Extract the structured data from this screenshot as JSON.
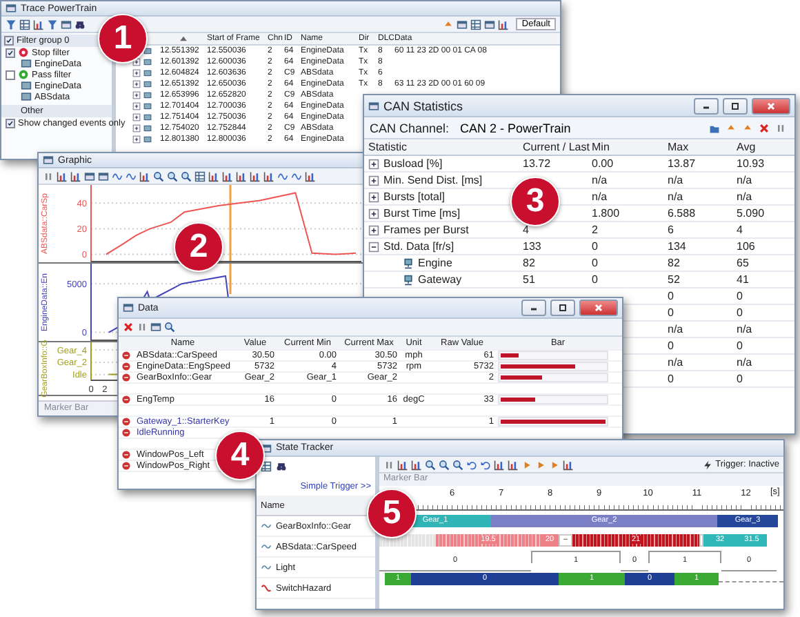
{
  "badges": [
    "1",
    "2",
    "3",
    "4",
    "5"
  ],
  "trace": {
    "title": "Trace PowerTrain",
    "view": "Default",
    "filter_group": {
      "label": "Filter group 0",
      "checked": true
    },
    "filters": [
      {
        "kind": "stop",
        "label": "Stop filter",
        "checked": true,
        "children": [
          "EngineData"
        ]
      },
      {
        "kind": "pass",
        "label": "Pass filter",
        "checked": false,
        "children": [
          "EngineData",
          "ABSdata"
        ]
      }
    ],
    "other_header": "Other",
    "options": [
      {
        "label": "Show changed events only",
        "checked": true
      }
    ],
    "columns": [
      "Start of Frame",
      "Chn",
      "ID",
      "Name",
      "Dir",
      "DLC",
      "Data"
    ],
    "rows": [
      {
        "time": "12.551392",
        "start": "12.550036",
        "chn": "2",
        "id": "64",
        "name": "EngineData",
        "dir": "Tx",
        "dlc": "8",
        "data": "60 11 23 2D 00 01 CA 08"
      },
      {
        "time": "12.601392",
        "start": "12.600036",
        "chn": "2",
        "id": "64",
        "name": "EngineData",
        "dir": "Tx",
        "dlc": "8"
      },
      {
        "time": "12.604824",
        "start": "12.603636",
        "chn": "2",
        "id": "C9",
        "name": "ABSdata",
        "dir": "Tx",
        "dlc": "6"
      },
      {
        "time": "12.651392",
        "start": "12.650036",
        "chn": "2",
        "id": "64",
        "name": "EngineData",
        "dir": "Tx",
        "dlc": "8",
        "data": "63 11 23 2D 00 01 60 09"
      },
      {
        "time": "12.653996",
        "start": "12.652820",
        "chn": "2",
        "id": "C9",
        "name": "ABSdata"
      },
      {
        "time": "12.701404",
        "start": "12.700036",
        "chn": "2",
        "id": "64",
        "name": "EngineData"
      },
      {
        "time": "12.751404",
        "start": "12.750036",
        "chn": "2",
        "id": "64",
        "name": "EngineData"
      },
      {
        "time": "12.754020",
        "start": "12.752844",
        "chn": "2",
        "id": "C9",
        "name": "ABSdata"
      },
      {
        "time": "12.801380",
        "start": "12.800036",
        "chn": "2",
        "id": "64",
        "name": "EngineData"
      }
    ]
  },
  "graphic": {
    "title": "Graphic",
    "marker_bar": "Marker Bar",
    "panels": [
      {
        "label": "ABSdata::CarSp",
        "color": "#ee5555",
        "ticks": [
          "40",
          "20",
          "0"
        ]
      },
      {
        "label": "EngineData::En",
        "color": "#4444bb",
        "ticks": [
          "5000",
          "0"
        ]
      },
      {
        "label": "GearBoxInfo::G",
        "color": "#a0a020",
        "ticks": [
          "Gear_4",
          "Gear_2",
          "Idle"
        ]
      }
    ],
    "x_ticks": [
      "0",
      "2"
    ]
  },
  "can": {
    "title": "CAN Statistics",
    "channel_label": "CAN Channel:",
    "channel": "CAN 2 - PowerTrain",
    "columns": [
      "Statistic",
      "Current / Last",
      "Min",
      "Max",
      "Avg"
    ],
    "rows": [
      {
        "name": "Busload [%]",
        "expanded": false,
        "current": "13.72",
        "min": "0.00",
        "max": "13.87",
        "avg": "10.93"
      },
      {
        "name": "Min. Send Dist. [ms]",
        "expanded": false,
        "min": "n/a",
        "max": "n/a",
        "avg": "n/a"
      },
      {
        "name": "Bursts [total]",
        "expanded": false,
        "min": "n/a",
        "max": "n/a",
        "avg": "n/a"
      },
      {
        "name": "Burst Time [ms]",
        "expanded": false,
        "min": "1.800",
        "max": "6.588",
        "avg": "5.090"
      },
      {
        "name": "Frames per Burst",
        "expanded": false,
        "current": "4",
        "min": "2",
        "max": "6",
        "avg": "4"
      },
      {
        "name": "Std. Data [fr/s]",
        "expanded": true,
        "current": "133",
        "min": "0",
        "max": "134",
        "avg": "106",
        "children": [
          {
            "name": "Engine",
            "current": "82",
            "min": "0",
            "max": "82",
            "avg": "65"
          },
          {
            "name": "Gateway",
            "current": "51",
            "min": "0",
            "max": "52",
            "avg": "41"
          }
        ]
      }
    ],
    "partial_rows": [
      {
        "max": "0",
        "avg": "0"
      },
      {
        "max": "0",
        "avg": "0"
      },
      {
        "max": "n/a",
        "avg": "n/a"
      },
      {
        "max": "0",
        "avg": "0"
      },
      {
        "max": "n/a",
        "avg": "n/a"
      },
      {
        "max": "0",
        "avg": "0"
      }
    ]
  },
  "data": {
    "title": "Data",
    "columns": [
      "Name",
      "Value",
      "Current Min",
      "Current Max",
      "Unit",
      "Raw Value",
      "Bar"
    ],
    "rows": [
      {
        "kind": "signal",
        "name": "ABSdata::CarSpeed",
        "color": "#222222",
        "value": "30.50",
        "min": "0.00",
        "max": "30.50",
        "unit": "mph",
        "raw": "61",
        "level": 0.17
      },
      {
        "kind": "signal",
        "name": "EngineData::EngSpeed",
        "color": "#222222",
        "value": "5732",
        "min": "4",
        "max": "5732",
        "unit": "rpm",
        "raw": "5732",
        "level": 0.71
      },
      {
        "kind": "signal",
        "name": "GearBoxInfo::Gear",
        "color": "#222222",
        "value": "Gear_2",
        "min": "Gear_1",
        "max": "Gear_2",
        "raw": "2",
        "level": 0.4
      },
      {
        "kind": "blank"
      },
      {
        "kind": "signal",
        "name": "EngTemp",
        "color": "#222222",
        "value": "16",
        "min": "0",
        "max": "16",
        "unit": "degC",
        "raw": "33",
        "level": 0.33
      },
      {
        "kind": "blank"
      },
      {
        "kind": "signal",
        "name": "Gateway_1::StarterKey",
        "color": "#3333aa",
        "value": "1",
        "min": "0",
        "max": "1",
        "raw": "1",
        "level": 1
      },
      {
        "kind": "signal",
        "name": "IdleRunning",
        "color": "#3333aa"
      },
      {
        "kind": "blank"
      },
      {
        "kind": "signal",
        "name": "WindowPos_Left",
        "color": "#222222"
      },
      {
        "kind": "signal",
        "name": "WindowPos_Right",
        "color": "#222222"
      }
    ]
  },
  "tracker": {
    "title": "State Tracker",
    "trigger_link": "Simple Trigger >>",
    "name_header": "Name",
    "trigger_status": "Trigger: Inactive",
    "marker_bar": "Marker Bar",
    "ruler": [
      "6",
      "7",
      "8",
      "9",
      "10",
      "11",
      "12"
    ],
    "unit": "[s]",
    "signals": [
      {
        "name": "GearBoxInfo::Gear",
        "digital": false,
        "kind": "bars",
        "segments": [
          {
            "label": "Gear_1",
            "color": "#2fb5b5"
          },
          {
            "label": "Gear_2",
            "color": "#7a7fc6"
          },
          {
            "label": "Gear_3",
            "color": "#24479c"
          }
        ]
      },
      {
        "name": "ABSdata::CarSpeed",
        "digital": false,
        "kind": "bars",
        "segments": [
          {
            "color": "#e4e4e4",
            "hatched": true
          },
          {
            "label": "19.5",
            "color": "#ee8088",
            "hatched": true
          },
          {
            "label": "20",
            "color": "#ee8088"
          },
          {
            "label": "–",
            "color": "#ffffff"
          },
          {
            "label": "21",
            "color": "#c0141e",
            "hatched": true
          },
          {
            "color": "#ffffff"
          },
          {
            "label": "32",
            "color": "#30b8b8"
          },
          {
            "label": "31.5",
            "color": "#30b8b8"
          }
        ]
      },
      {
        "name": "Light",
        "digital": false,
        "kind": "steps",
        "states": [
          {
            "label": "0",
            "high": false
          },
          {
            "label": "1",
            "high": true
          },
          {
            "label": "0",
            "high": false
          },
          {
            "label": "1",
            "high": true
          },
          {
            "label": "0",
            "high": false
          }
        ]
      },
      {
        "name": "SwitchHazard",
        "digital": true,
        "kind": "bars",
        "segments": [
          {
            "label": "1",
            "color": "#3aaa35"
          },
          {
            "label": "0",
            "color": "#1f3f94"
          },
          {
            "label": "1",
            "color": "#3aaa35"
          },
          {
            "label": "0",
            "color": "#1f3f94"
          },
          {
            "label": "1",
            "color": "#3aaa35"
          }
        ]
      }
    ]
  }
}
